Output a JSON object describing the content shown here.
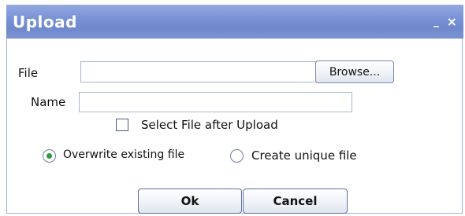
{
  "dialog": {
    "title": "Upload",
    "minimize_glyph": "_",
    "close_glyph": "×"
  },
  "form": {
    "file_label": "File",
    "file_value": "",
    "browse_label": "Browse...",
    "name_label": "Name",
    "name_value": "",
    "select_after_upload_label": "Select File after Upload",
    "select_after_upload_checked": false,
    "options": [
      {
        "label": "Overwrite existing file",
        "selected": true
      },
      {
        "label": "Create unique file",
        "selected": false
      }
    ]
  },
  "footer": {
    "ok_label": "Ok",
    "cancel_label": "Cancel"
  },
  "colors": {
    "titlebar": "#7d96d8",
    "radio_selected": "#2d9c3c"
  }
}
